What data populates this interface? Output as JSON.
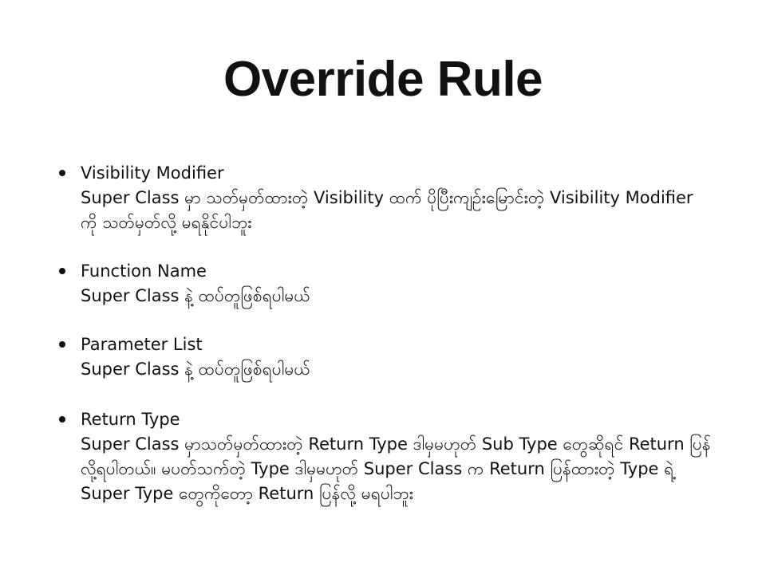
{
  "slide": {
    "title": "Override Rule",
    "bullets": [
      {
        "heading": "Visibility Modifier",
        "text": "Super Class မှာ သတ်မှတ်ထားတဲ့ Visibility ထက် ပိုပြီးကျဉ်းမြောင်းတဲ့ Visibility Modifier ကို သတ်မှတ်လို့ မရနိုင်ပါဘူး"
      },
      {
        "heading": "Function Name",
        "text": "Super Class နဲ့ ထပ်တူဖြစ်ရပါမယ်"
      },
      {
        "heading": "Parameter List",
        "text": "Super Class နဲ့ ထပ်တူဖြစ်ရပါမယ်"
      },
      {
        "heading": "Return Type",
        "text": "Super Class မှာသတ်မှတ်ထားတဲ့ Return Type ဒါမှမဟုတ် Sub Type တွေဆိုရင် Return ပြန်လို့ရပါတယ်။ မပတ်သက်တဲ့ Type ဒါမှမဟုတ် Super Class က Return ပြန်ထားတဲ့ Type ရဲ့ Super Type တွေကိုတော့ Return ပြန်လို့ မရပါဘူး"
      }
    ]
  }
}
